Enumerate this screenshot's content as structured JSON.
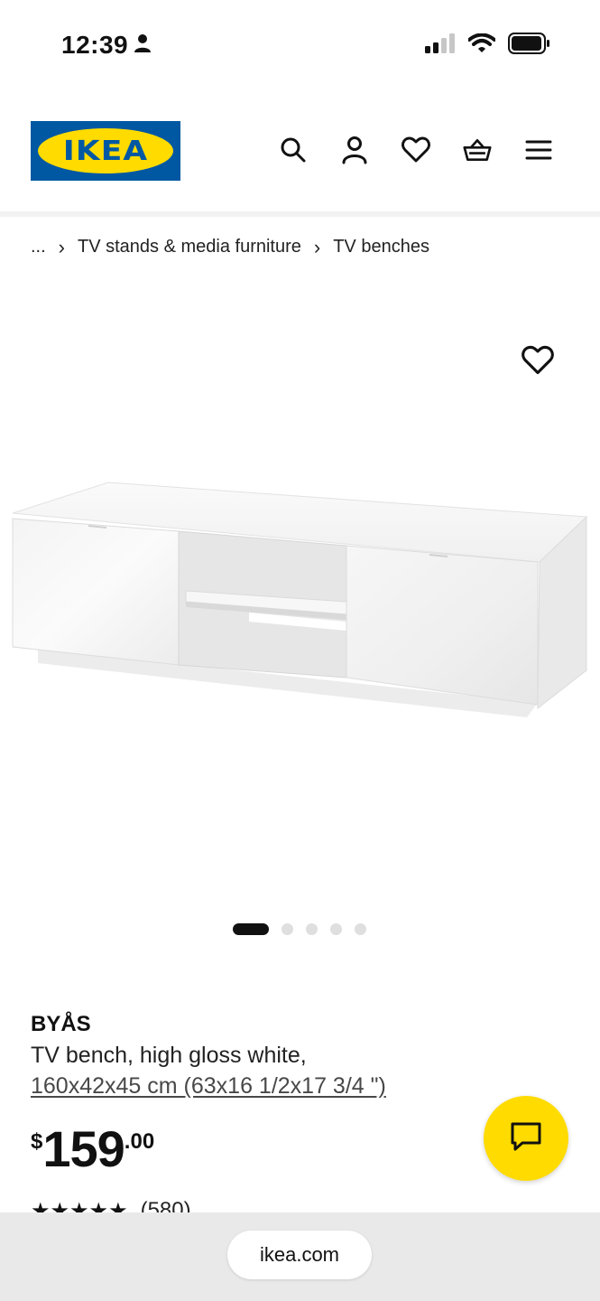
{
  "status_bar": {
    "time": "12:39",
    "icons": [
      "person-icon",
      "cellular-signal-icon",
      "wifi-icon",
      "battery-icon"
    ]
  },
  "header": {
    "logo_text": "IKEA",
    "icons": [
      "search-icon",
      "account-icon",
      "heart-icon",
      "basket-icon",
      "menu-icon"
    ]
  },
  "breadcrumb": {
    "items": [
      "...",
      "TV stands & media furniture",
      "TV benches"
    ],
    "separator": "›"
  },
  "gallery": {
    "image_alt": "BYÅS TV bench, high gloss white",
    "total_slides": 5,
    "active_slide": 1
  },
  "product": {
    "name": "BYÅS",
    "description": "TV bench, high gloss white,",
    "size": "160x42x45 cm (63x16 1/2x17 3/4 \")",
    "price": {
      "currency": "$",
      "integer": "159",
      "decimal": ".00"
    },
    "rating": {
      "stars": "★★★★★",
      "count": "(580)"
    }
  },
  "browser": {
    "url": "ikea.com"
  },
  "colors": {
    "ikea_blue": "#0058a3",
    "ikea_yellow": "#ffdb00"
  }
}
